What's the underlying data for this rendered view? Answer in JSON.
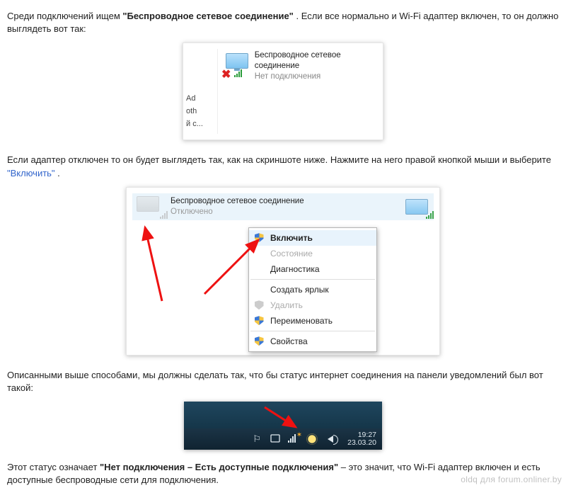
{
  "para1": {
    "pre": "Среди подключений ищем ",
    "bold": "\"Беспроводное сетевое соединение\"",
    "post": ". Если все нормально и Wi-Fi адаптер включен, то он должно выглядеть вот так:"
  },
  "img1": {
    "left_fragments": [
      "Ad",
      "oth",
      "й с..."
    ],
    "adapter_title": "Беспроводное сетевое соединение",
    "adapter_status": "Нет подключения"
  },
  "para2": {
    "pre": "Если адаптер отключен то он будет выглядеть так, как на скриншоте ниже. Нажмите на него правой кнопкой мыши и выберите ",
    "link": "\"Включить\"",
    "post": "."
  },
  "img2": {
    "adapter_title": "Беспроводное сетевое соединение",
    "adapter_status": "Отключено",
    "menu": {
      "enable": "Включить",
      "status": "Состояние",
      "diag": "Диагностика",
      "shortcut": "Создать ярлык",
      "delete": "Удалить",
      "rename": "Переименовать",
      "props": "Свойства"
    }
  },
  "para3": "Описанными выше способами,  мы должны сделать так, что бы статус интернет соединения на панели уведомлений был вот такой:",
  "img3": {
    "time": "19:27",
    "date": "23.03.20"
  },
  "para4": {
    "pre": "Этот статус означает ",
    "bold": "\"Нет подключения – Есть доступные подключения\"",
    "post": " – это значит, что Wi-Fi адаптер включен и есть доступные беспроводные сети для подключения."
  },
  "watermark": "oldq для forum.onliner.by"
}
